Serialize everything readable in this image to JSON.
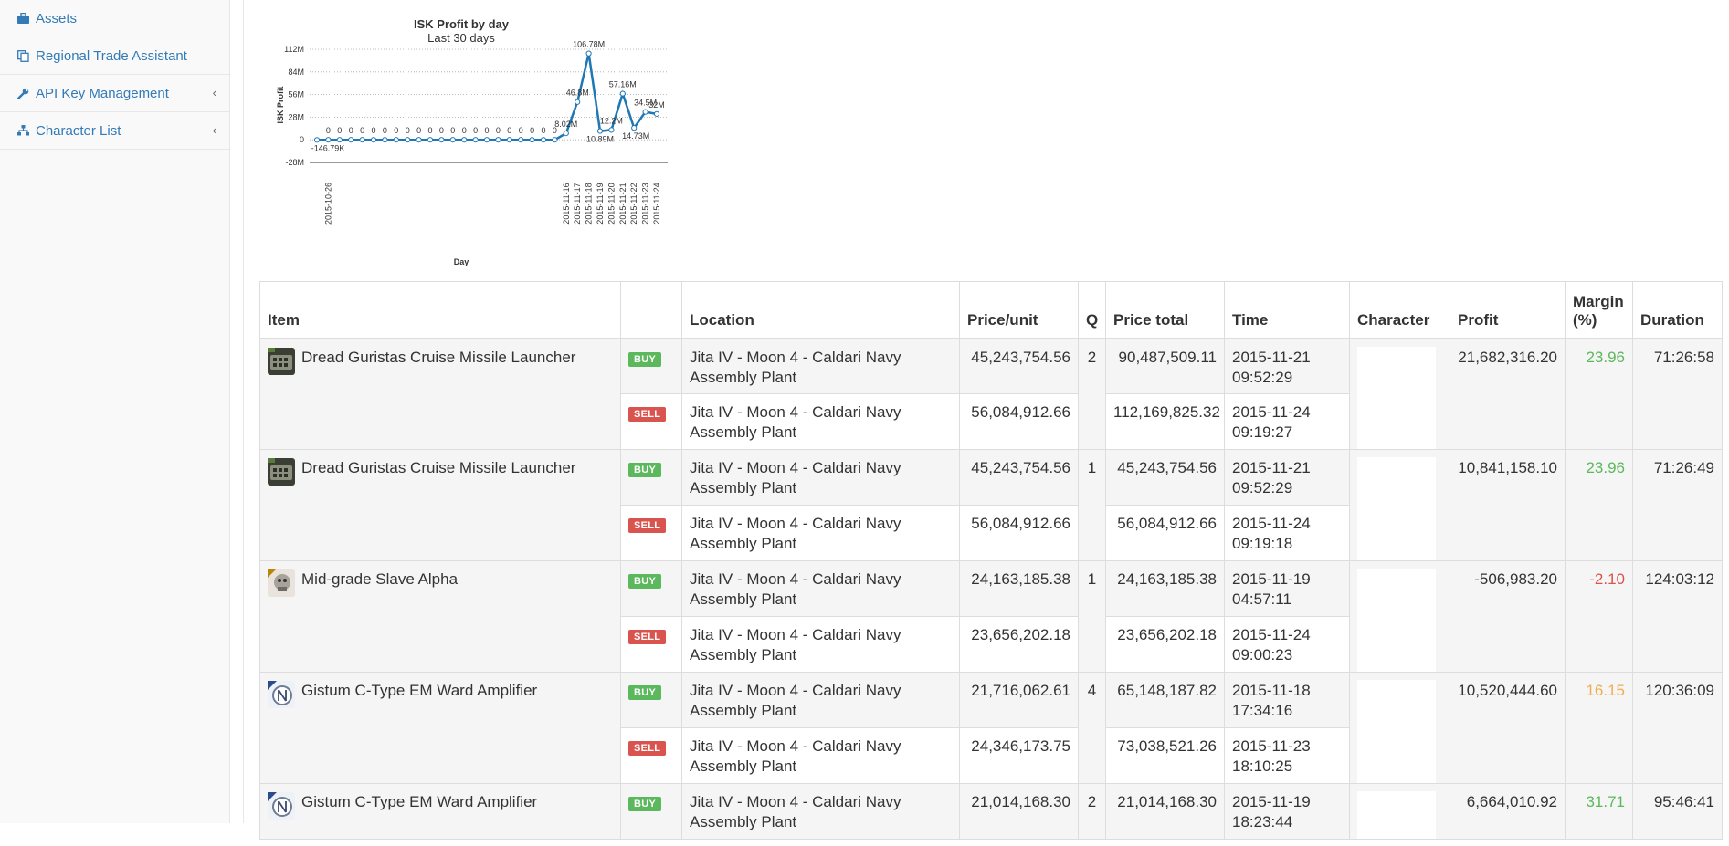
{
  "sidebar": {
    "items": [
      {
        "label": "Assets",
        "icon": "briefcase-icon",
        "chevron": ""
      },
      {
        "label": "Regional Trade Assistant",
        "icon": "copy-icon",
        "chevron": ""
      },
      {
        "label": "API Key Management",
        "icon": "wrench-icon",
        "chevron": "‹"
      },
      {
        "label": "Character List",
        "icon": "sitemap-icon",
        "chevron": "‹"
      }
    ]
  },
  "chart_data": {
    "type": "line",
    "title": "ISK Profit by day",
    "subtitle": "Last 30 days",
    "xlabel": "Day",
    "ylabel": "ISK Profit",
    "y_ticks": [
      "112M",
      "84M",
      "56M",
      "28M",
      "0",
      "-28M"
    ],
    "ylim": [
      -28,
      112
    ],
    "y_unit": "M ISK",
    "grid": true,
    "x_tick_labels": [
      "2015-10-26",
      "2015-11-16",
      "2015-11-17",
      "2015-11-18",
      "2015-11-19",
      "2015-11-20",
      "2015-11-21",
      "2015-11-22",
      "2015-11-23",
      "2015-11-24"
    ],
    "series": [
      {
        "color": "#1f77b4",
        "values": [
          -0.14679,
          0,
          0,
          0,
          0,
          0,
          0,
          0,
          0,
          0,
          0,
          0,
          0,
          0,
          0,
          0,
          0,
          0,
          0,
          0,
          0,
          0,
          8.02,
          46.8,
          106.78,
          10.89,
          12.2,
          57.16,
          14.73,
          34.5,
          32
        ],
        "labels": [
          "-146.79K",
          "0",
          "0",
          "0",
          "0",
          "0",
          "0",
          "0",
          "0",
          "0",
          "0",
          "0",
          "0",
          "0",
          "0",
          "0",
          "0",
          "0",
          "0",
          "0",
          "0",
          "0",
          "8.02M",
          "46.8M",
          "106.78M",
          "10.89M",
          "12.2M",
          "57.16M",
          "14.73M",
          "34.5M",
          "32M"
        ]
      }
    ]
  },
  "table": {
    "headers": [
      "Item",
      "",
      "Location",
      "Price/unit",
      "Q",
      "Price total",
      "Time",
      "Character",
      "Profit",
      "Margin (%)",
      "Duration"
    ],
    "groups": [
      {
        "item": "Dread Guristas Cruise Missile Launcher",
        "icon": "missile-launcher-icon",
        "q": "2",
        "profit": "21,682,316.20",
        "margin": "23.96",
        "margin_color": "#5cb85c",
        "duration": "71:26:58",
        "buy": {
          "badge": "BUY",
          "location": "Jita IV - Moon 4 - Caldari Navy Assembly Plant",
          "price_unit": "45,243,754.56",
          "price_total": "90,487,509.11",
          "time": "2015-11-21 09:52:29"
        },
        "sell": {
          "badge": "SELL",
          "location": "Jita IV - Moon 4 - Caldari Navy Assembly Plant",
          "price_unit": "56,084,912.66",
          "price_total": "112,169,825.32",
          "time": "2015-11-24 09:19:27"
        }
      },
      {
        "item": "Dread Guristas Cruise Missile Launcher",
        "icon": "missile-launcher-icon",
        "q": "1",
        "profit": "10,841,158.10",
        "margin": "23.96",
        "margin_color": "#5cb85c",
        "duration": "71:26:49",
        "buy": {
          "badge": "BUY",
          "location": "Jita IV - Moon 4 - Caldari Navy Assembly Plant",
          "price_unit": "45,243,754.56",
          "price_total": "45,243,754.56",
          "time": "2015-11-21 09:52:29"
        },
        "sell": {
          "badge": "SELL",
          "location": "Jita IV - Moon 4 - Caldari Navy Assembly Plant",
          "price_unit": "56,084,912.66",
          "price_total": "56,084,912.66",
          "time": "2015-11-24 09:19:18"
        }
      },
      {
        "item": "Mid-grade Slave Alpha",
        "icon": "implant-icon",
        "q": "1",
        "profit": "-506,983.20",
        "margin": "-2.10",
        "margin_color": "#d9534f",
        "duration": "124:03:12",
        "buy": {
          "badge": "BUY",
          "location": "Jita IV - Moon 4 - Caldari Navy Assembly Plant",
          "price_unit": "24,163,185.38",
          "price_total": "24,163,185.38",
          "time": "2015-11-19 04:57:11"
        },
        "sell": {
          "badge": "SELL",
          "location": "Jita IV - Moon 4 - Caldari Navy Assembly Plant",
          "price_unit": "23,656,202.18",
          "price_total": "23,656,202.18",
          "time": "2015-11-24 09:00:23"
        }
      },
      {
        "item": "Gistum C-Type EM Ward Amplifier",
        "icon": "shield-amplifier-icon",
        "q": "4",
        "profit": "10,520,444.60",
        "margin": "16.15",
        "margin_color": "#f0ad4e",
        "duration": "120:36:09",
        "buy": {
          "badge": "BUY",
          "location": "Jita IV - Moon 4 - Caldari Navy Assembly Plant",
          "price_unit": "21,716,062.61",
          "price_total": "65,148,187.82",
          "time": "2015-11-18 17:34:16"
        },
        "sell": {
          "badge": "SELL",
          "location": "Jita IV - Moon 4 - Caldari Navy Assembly Plant",
          "price_unit": "24,346,173.75",
          "price_total": "73,038,521.26",
          "time": "2015-11-23 18:10:25"
        }
      },
      {
        "item": "Gistum C-Type EM Ward Amplifier",
        "icon": "shield-amplifier-icon",
        "q": "2",
        "profit": "6,664,010.92",
        "margin": "31.71",
        "margin_color": "#5cb85c",
        "duration": "95:46:41",
        "buy": {
          "badge": "BUY",
          "location": "Jita IV - Moon 4 - Caldari Navy Assembly Plant",
          "price_unit": "21,014,168.30",
          "price_total": "21,014,168.30",
          "time": "2015-11-19 18:23:44"
        },
        "sell": null
      }
    ]
  }
}
